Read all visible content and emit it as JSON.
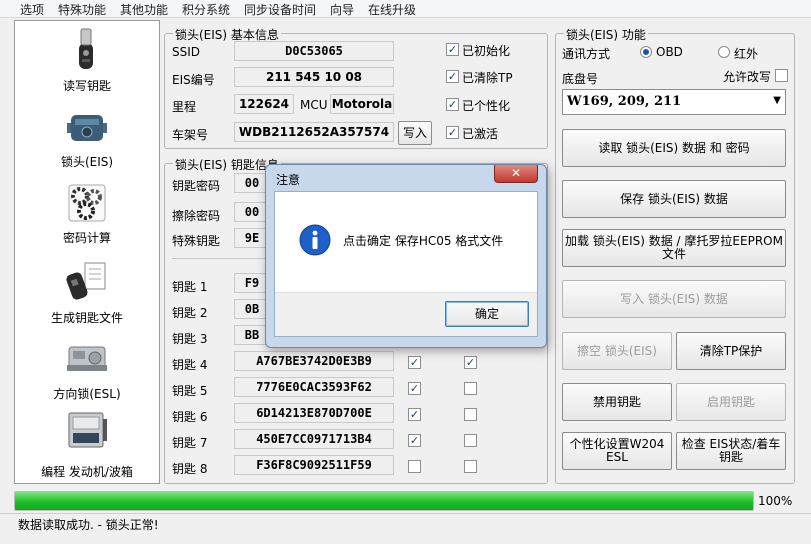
{
  "menu": [
    "选项",
    "特殊功能",
    "其他功能",
    "积分系统",
    "同步设备时间",
    "向导",
    "在线升级"
  ],
  "nav": [
    {
      "label": "读写钥匙",
      "icon": "car-key-icon"
    },
    {
      "label": "锁头(EIS)",
      "icon": "ignition-lock-icon"
    },
    {
      "label": "密码计算",
      "icon": "gears-icon"
    },
    {
      "label": "生成钥匙文件",
      "icon": "key-file-icon"
    },
    {
      "label": "方向锁(ESL)",
      "icon": "steering-lock-icon"
    },
    {
      "label": "编程 发动机/波箱",
      "icon": "ecu-module-icon"
    }
  ],
  "eis_info": {
    "title": "锁头(EIS) 基本信息",
    "ssid_label": "SSID",
    "ssid": "D0C53065",
    "eis_no_label": "EIS编号",
    "eis_no": "211 545 10 08",
    "mileage_label": "里程",
    "mileage": "122624",
    "mcu_label": "MCU",
    "mcu": "Motorola",
    "vin_label": "车架号",
    "vin": "WDB2112652A357574",
    "write_btn": "写入",
    "checks": [
      {
        "label": "已初始化",
        "checked": true
      },
      {
        "label": "已清除TP",
        "checked": true
      },
      {
        "label": "已个性化",
        "checked": true
      },
      {
        "label": "已激活",
        "checked": true
      }
    ]
  },
  "key_info": {
    "title": "锁头(EIS) 钥匙信息",
    "key_password_label": "钥匙密码",
    "key_password": "00",
    "erase_password_label": "擦除密码",
    "erase_password": "00",
    "special_key_label": "特殊钥匙",
    "special_key": "9E",
    "keys": [
      {
        "label": "钥匙 1",
        "value": "F9",
        "check1": null,
        "check2": null
      },
      {
        "label": "钥匙 2",
        "value": "0B",
        "check1": null,
        "check2": null
      },
      {
        "label": "钥匙 3",
        "value": "BB",
        "check1": null,
        "check2": null
      },
      {
        "label": "钥匙 4",
        "value": "A767BE3742D0E3B9",
        "check1": true,
        "check2": true
      },
      {
        "label": "钥匙 5",
        "value": "7776E0CAC3593F62",
        "check1": true,
        "check2": false
      },
      {
        "label": "钥匙 6",
        "value": "6D14213E870D700E",
        "check1": true,
        "check2": false
      },
      {
        "label": "钥匙 7",
        "value": "450E7CC0971713B4",
        "check1": true,
        "check2": false
      },
      {
        "label": "钥匙 8",
        "value": "F36F8C9092511F59",
        "check1": false,
        "check2": false
      }
    ]
  },
  "eis_func": {
    "title": "锁头(EIS) 功能",
    "comm_label": "通讯方式",
    "obd_label": "OBD",
    "ir_label": "红外",
    "chassis_label": "底盘号",
    "allow_rewrite_label": "允许改写",
    "chassis_value": "W169, 209, 211",
    "buttons": {
      "read_eis": "读取 锁头(EIS) 数据 和 密码",
      "save_eis": "保存 锁头(EIS) 数据",
      "load_eis": "加载 锁头(EIS) 数据 / 摩托罗拉EEPROM 文件",
      "write_eis": "写入 锁头(EIS) 数据",
      "erase_eis": "擦空 锁头(EIS)",
      "clear_tp": "清除TP保护",
      "disable_key": "禁用钥匙",
      "enable_key": "启用钥匙",
      "personalize": "个性化设置W204 ESL",
      "check_status": "检查 EIS状态/着车钥匙"
    }
  },
  "progress": {
    "value": 100,
    "label": "100%"
  },
  "status_text": "数据读取成功. - 锁头正常!",
  "dialog": {
    "title": "注意",
    "message": "点击确定 保存HC05 格式文件",
    "ok_label": "确定",
    "icon": "info-icon"
  },
  "colors": {
    "progress": "#1dbd2a",
    "info_icon": "#1f5fc8",
    "close_button": "#c9463d"
  }
}
